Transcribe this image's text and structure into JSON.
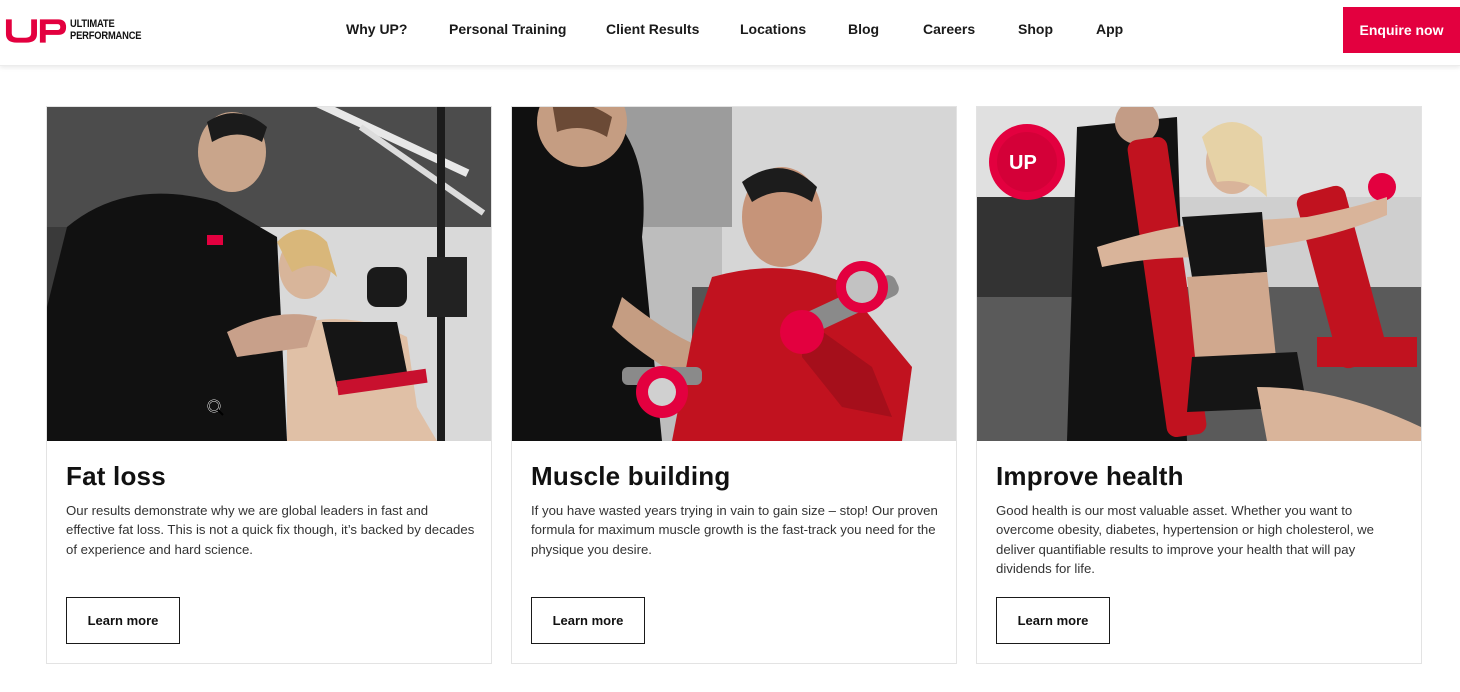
{
  "header": {
    "logo": {
      "mark": "UP",
      "line1": "ULTIMATE",
      "line2": "PERFORMANCE"
    },
    "nav": [
      {
        "label": "Why UP?"
      },
      {
        "label": "Personal Training"
      },
      {
        "label": "Client Results"
      },
      {
        "label": "Locations"
      },
      {
        "label": "Blog"
      },
      {
        "label": "Careers"
      },
      {
        "label": "Shop"
      },
      {
        "label": "App"
      }
    ],
    "cta_label": "Enquire now"
  },
  "colors": {
    "brand_red": "#e3003f",
    "text_dark": "#111111",
    "border": "#e3e3e3"
  },
  "cards": [
    {
      "title": "Fat loss",
      "description": "Our results demonstrate why we are global leaders in fast and effective fat loss. This is not a quick fix though, it’s backed by decades of experience and hard science.",
      "button_label": "Learn more",
      "image_icon": "photo-trainer-coaching-woman-cable-row"
    },
    {
      "title": "Muscle building",
      "description": "If you have wasted years trying in vain to gain size – stop! Our proven formula for maximum muscle growth is the fast-track you need for the physique you desire.",
      "button_label": "Learn more",
      "image_icon": "photo-man-dumbbell-curl-with-trainer"
    },
    {
      "title": "Improve health",
      "description": "Good health is our most valuable asset. Whether you want to overcome obesity, diabetes, hypertension or high cholesterol, we deliver quantifiable results to improve your health that will pay dividends for life.",
      "button_label": "Learn more",
      "image_icon": "photo-woman-lateral-raise-with-trainer"
    }
  ]
}
